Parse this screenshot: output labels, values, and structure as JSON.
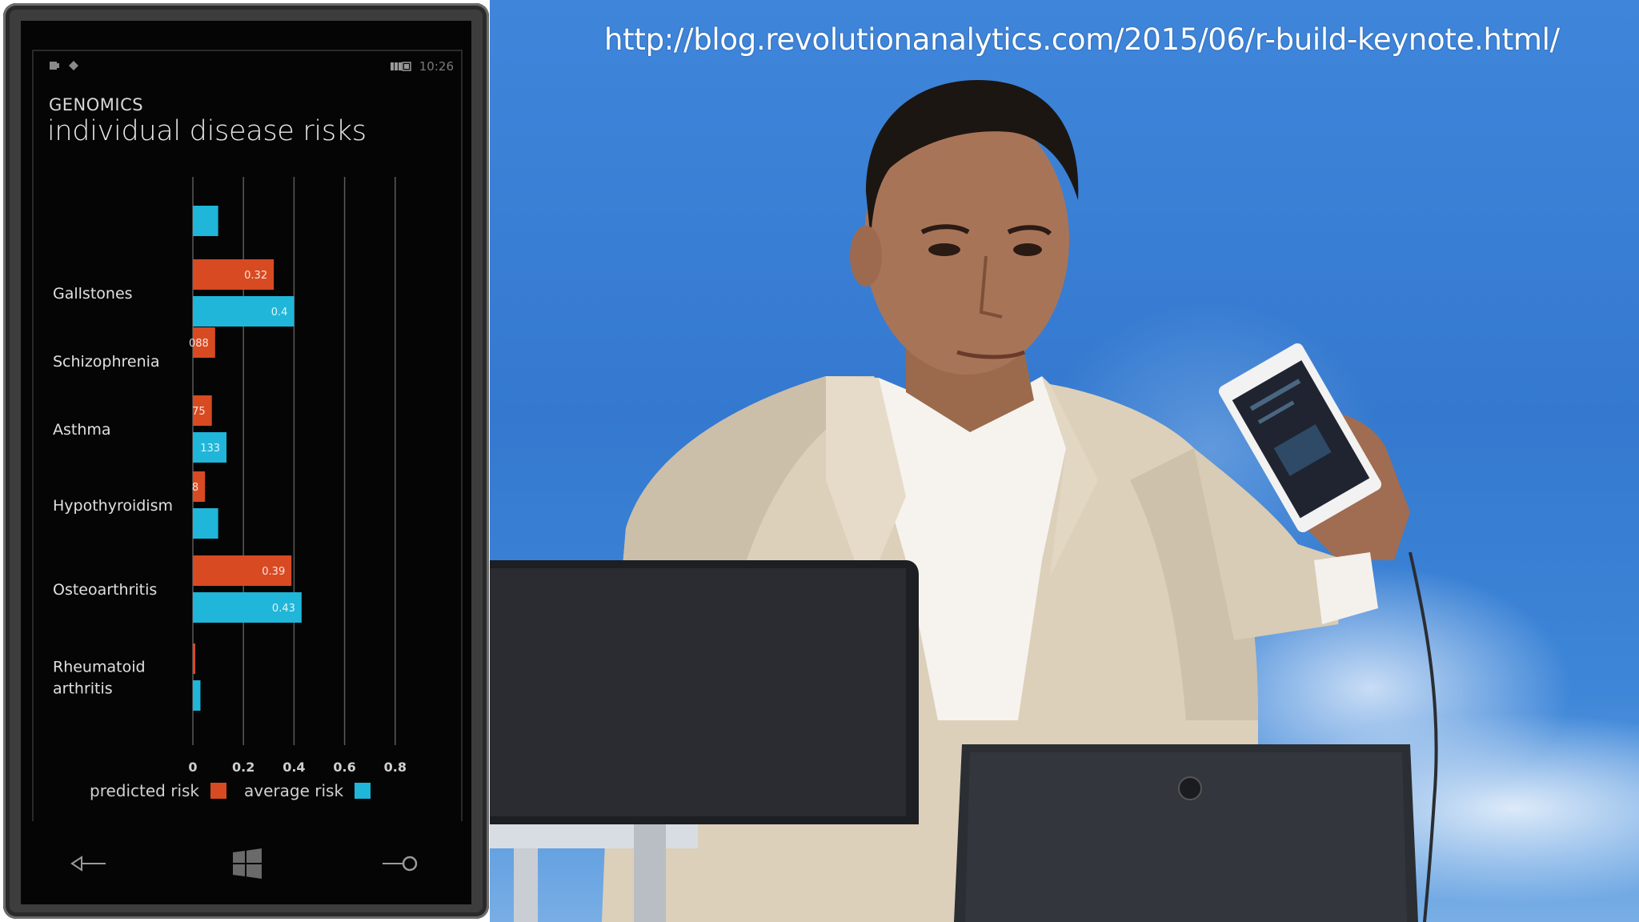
{
  "video": {
    "url_caption": "http://blog.revolutionanalytics.com/2015/06/r-build-keynote.html/"
  },
  "phone": {
    "status_time": "10:26",
    "section": "GENOMICS",
    "title": "individual disease risks",
    "legend": {
      "predicted_label": "predicted risk",
      "average_label": "average risk"
    },
    "nav": {
      "back": "back-icon",
      "start": "windows-logo-icon",
      "search": "search-icon"
    }
  },
  "colors": {
    "predicted": "#d84a22",
    "average": "#1fb6d9",
    "background": "#050505"
  },
  "chart_data": {
    "type": "bar",
    "orientation": "horizontal",
    "title": "individual disease risks",
    "categories": [
      "",
      "Gallstones",
      "Schizophrenia",
      "Asthma",
      "Hypothyroidism",
      "Osteoarthritis",
      "Rheumatoid arthritis"
    ],
    "category_lines": [
      [
        ""
      ],
      [
        "Gallstones"
      ],
      [
        "Schizophrenia"
      ],
      [
        "Asthma"
      ],
      [
        "Hypothyroidism"
      ],
      [
        "Osteoarthritis"
      ],
      [
        "Rheumatoid",
        "arthritis"
      ]
    ],
    "series": [
      {
        "name": "predicted risk",
        "values": [
          null,
          0.32,
          0.088,
          0.075,
          0.048,
          0.39,
          0.006
        ],
        "labels": [
          "",
          "0.32",
          "088",
          "75",
          "8",
          "0.39",
          ""
        ]
      },
      {
        "name": "average risk",
        "values": [
          0.1,
          0.4,
          null,
          0.133,
          0.1,
          0.43,
          0.03
        ],
        "labels": [
          "",
          "0.4",
          "",
          "133",
          "",
          "0.43",
          ""
        ]
      }
    ],
    "xticks": [
      "0",
      "0.2",
      "0.4",
      "0.6",
      "0.8"
    ],
    "xlim": [
      0,
      0.8
    ],
    "grid": true,
    "legend": "bottom"
  }
}
